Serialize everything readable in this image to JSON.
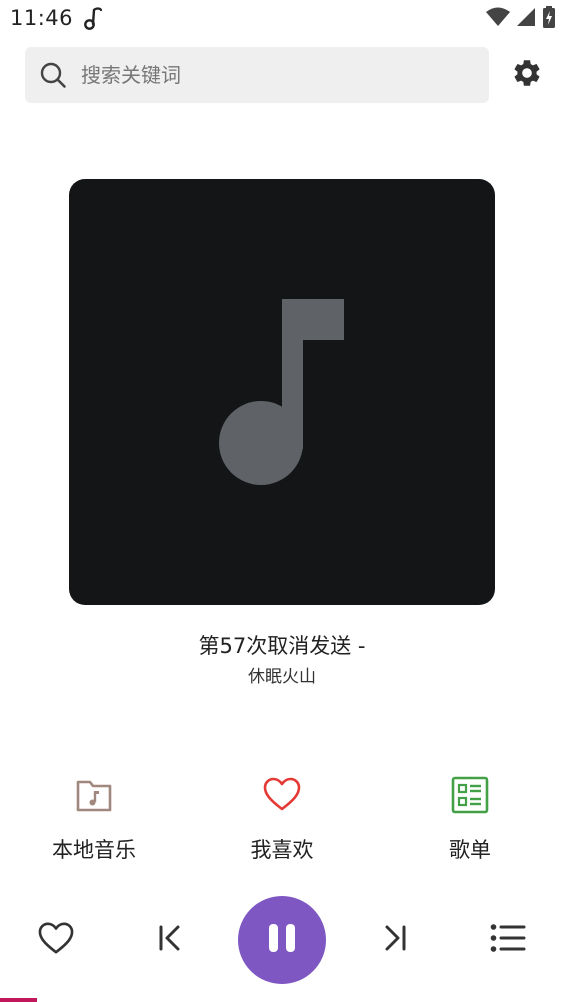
{
  "status_bar": {
    "time": "11:46",
    "app_icon": "music-note-icon",
    "icons": [
      "wifi-icon",
      "cellular-signal-icon",
      "battery-charging-icon"
    ]
  },
  "search": {
    "placeholder": "搜索关键词",
    "value": ""
  },
  "settings": {
    "icon": "gear-icon"
  },
  "now_playing": {
    "title": "第57次取消发送 -",
    "artist": "休眠火山",
    "cover_icon": "music-note-icon"
  },
  "shortcuts": [
    {
      "label": "本地音乐",
      "icon": "music-folder-icon",
      "color": "#a1887f"
    },
    {
      "label": "我喜欢",
      "icon": "heart-icon",
      "color": "#e53935"
    },
    {
      "label": "歌单",
      "icon": "playlist-icon",
      "color": "#43a047"
    }
  ],
  "player": {
    "favorite_icon": "heart-outline-icon",
    "previous_icon": "skip-previous-icon",
    "play_pause_icon": "pause-icon",
    "next_icon": "skip-next-icon",
    "queue_icon": "queue-list-icon",
    "progress": 0.065
  },
  "colors": {
    "accent": "#7e57c2",
    "cover_background": "#141517",
    "cover_note": "#5f6368",
    "progress": "#c2185b",
    "search_background": "#efefef"
  }
}
